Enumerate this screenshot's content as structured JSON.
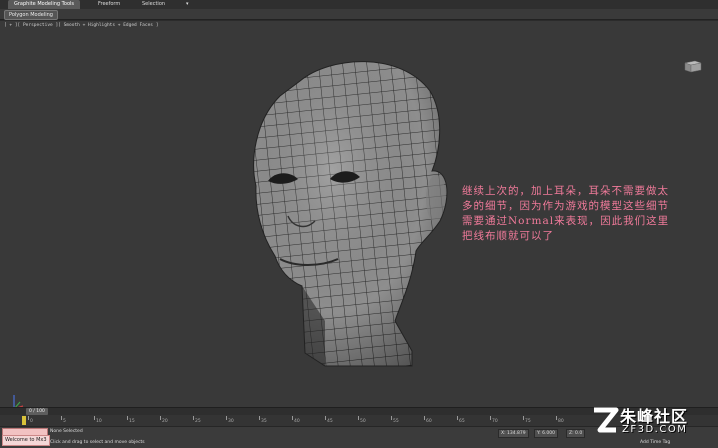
{
  "ribbon": {
    "tabs": [
      "Graphite Modeling Tools",
      "Freeform",
      "Selection",
      "▾"
    ],
    "panel": "Polygon Modeling"
  },
  "viewport": {
    "label": "[ + ][ Perspective ][ Smooth + Highlights + Edged Faces ]"
  },
  "annotation": {
    "text": "继续上次的，加上耳朵，耳朵不需要做太多的细节，因为作为游戏的模型这些细节需要通过Normal来表现，因此我们这里把线布顺就可以了"
  },
  "timeslider": {
    "position": "0 / 100"
  },
  "ruler": {
    "labels": [
      "0",
      "5",
      "10",
      "15",
      "20",
      "25",
      "30",
      "35",
      "40",
      "45",
      "50",
      "55",
      "60",
      "65",
      "70",
      "75",
      "80"
    ]
  },
  "status": {
    "welcome": "Welcome to Mx3",
    "selection": "None Selected",
    "prompt": "Click and drag to select and move objects",
    "x_value": "X: 134.879",
    "y_value": "Y: 6.000",
    "z_value": "Z: 0.0",
    "add_time_tag": "Add Time Tag"
  },
  "watermark": {
    "brand": "朱峰社区",
    "url": "ZF3D.COM"
  },
  "colors": {
    "annotation_text": "#f07a9a",
    "viewport_bg": "#393939",
    "mesh_face": "#8d8d8d",
    "mesh_wire": "#2a2a2a"
  }
}
